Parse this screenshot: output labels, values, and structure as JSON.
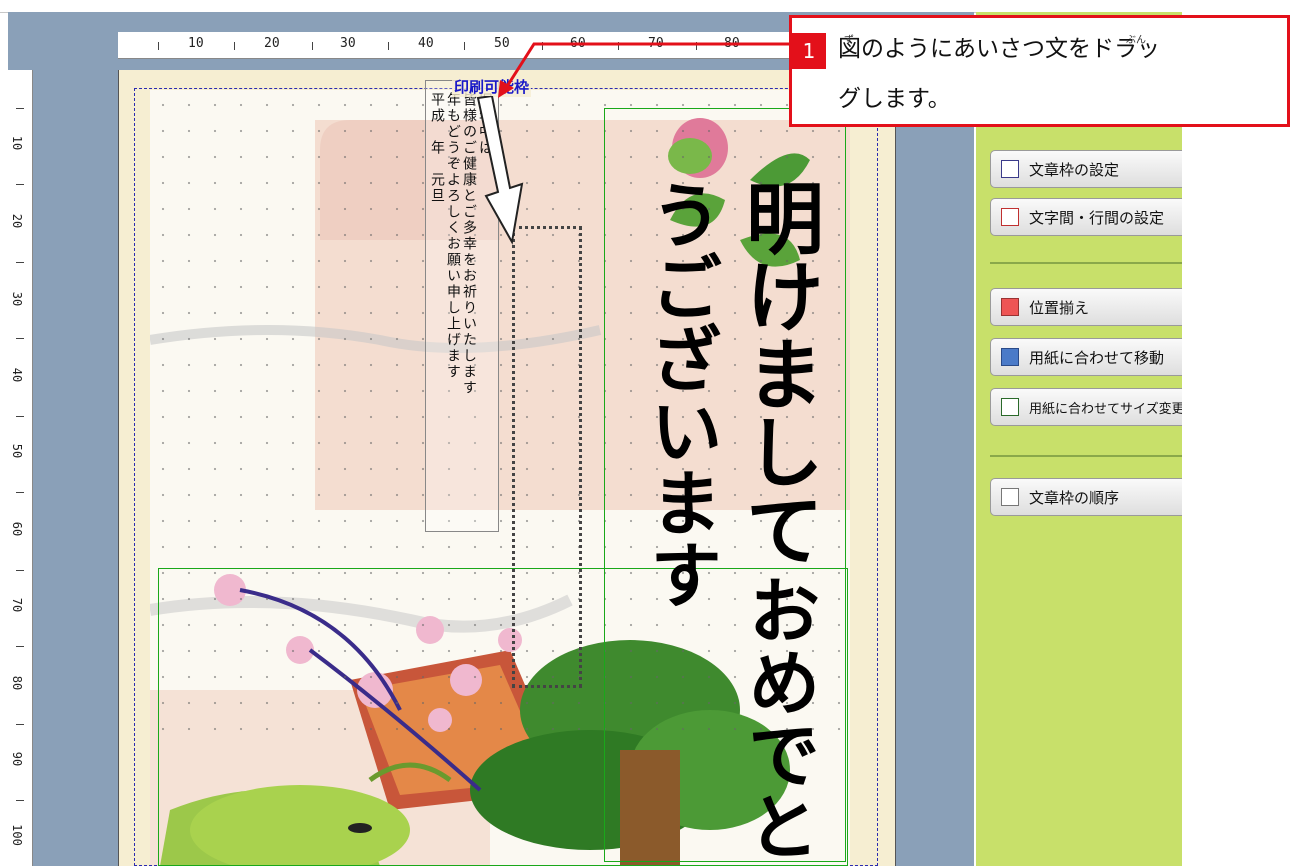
{
  "ruler": {
    "top_marks": [
      "10",
      "20",
      "30",
      "40",
      "50",
      "60",
      "70",
      "80"
    ],
    "left_marks": [
      "10",
      "20",
      "30",
      "40",
      "50",
      "60",
      "70",
      "80",
      "90",
      "100"
    ]
  },
  "canvas": {
    "printable_label": "印刷可能枠",
    "greeting_lines": [
      "旧年中は",
      "年もどうぞよろしくお願い申し上げます",
      "平成　年　元旦"
    ],
    "greeting_line2": "皆様のご健康とご多幸をお祈りいたします",
    "calligraphy_line1": "明けまして",
    "calligraphy_line2": "おめでとうございます"
  },
  "side_panel": {
    "buttons": [
      {
        "label": "文章枠の設定",
        "icon": "text-frame-settings-icon"
      },
      {
        "label": "文字間・行間の設定",
        "icon": "spacing-icon"
      },
      {
        "label": "位置揃え",
        "icon": "align-icon"
      },
      {
        "label": "用紙に合わせて移動",
        "icon": "fit-move-icon"
      },
      {
        "label": "用紙に合わせてサイズ変更",
        "icon": "fit-resize-icon"
      },
      {
        "label": "文章枠の順序",
        "icon": "order-icon"
      }
    ]
  },
  "callout": {
    "number": "1",
    "text_line1": "図のようにあいさつ文をドラッ",
    "text_line2": "グします。",
    "ruby_zu": "ず",
    "ruby_bun": "ぶん"
  },
  "colors": {
    "callout_red": "#e3101a",
    "panel_green": "#c8e06a",
    "frame_green": "#1aa81a",
    "margin_blue": "#2a2ab0"
  }
}
